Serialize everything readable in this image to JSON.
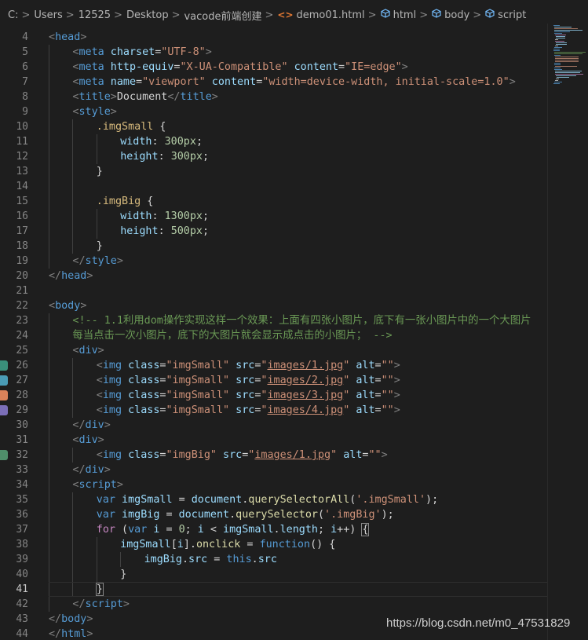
{
  "breadcrumb": {
    "items": [
      "C:",
      "Users",
      "12525",
      "Desktop",
      "vacode前端创建",
      "demo01.html",
      "html",
      "body",
      "script"
    ],
    "separator": ">"
  },
  "editor": {
    "active_line": 41,
    "lines": [
      {
        "n": "4"
      },
      {
        "n": "5"
      },
      {
        "n": "6"
      },
      {
        "n": "7"
      },
      {
        "n": "8"
      },
      {
        "n": "9"
      },
      {
        "n": "10"
      },
      {
        "n": "11"
      },
      {
        "n": "12"
      },
      {
        "n": "13"
      },
      {
        "n": "14"
      },
      {
        "n": "15"
      },
      {
        "n": "16"
      },
      {
        "n": "17"
      },
      {
        "n": "18"
      },
      {
        "n": "19"
      },
      {
        "n": "20"
      },
      {
        "n": "21"
      },
      {
        "n": "22"
      },
      {
        "n": "23"
      },
      {
        "n": "24"
      },
      {
        "n": "25"
      },
      {
        "n": "26"
      },
      {
        "n": "27"
      },
      {
        "n": "28"
      },
      {
        "n": "29"
      },
      {
        "n": "30"
      },
      {
        "n": "31"
      },
      {
        "n": "32"
      },
      {
        "n": "33"
      },
      {
        "n": "34"
      },
      {
        "n": "35"
      },
      {
        "n": "36"
      },
      {
        "n": "37"
      },
      {
        "n": "38"
      },
      {
        "n": "39"
      },
      {
        "n": "40"
      },
      {
        "n": "41"
      },
      {
        "n": "42"
      },
      {
        "n": "43"
      },
      {
        "n": "44"
      }
    ],
    "code": {
      "l4": [
        "<",
        "head",
        ">"
      ],
      "l5": [
        "<",
        "meta",
        " ",
        "charset",
        "=",
        "\"UTF-8\"",
        ">"
      ],
      "l6": [
        "<",
        "meta",
        " ",
        "http-equiv",
        "=",
        "\"X-UA-Compatible\"",
        " ",
        "content",
        "=",
        "\"IE=edge\"",
        ">"
      ],
      "l7": [
        "<",
        "meta",
        " ",
        "name",
        "=",
        "\"viewport\"",
        " ",
        "content",
        "=",
        "\"width=device-width, initial-scale=1.0\"",
        ">"
      ],
      "l8": [
        "<",
        "title",
        ">",
        "Document",
        "</",
        "title",
        ">"
      ],
      "l9": [
        "<",
        "style",
        ">"
      ],
      "l10": [
        ".imgSmall",
        " {"
      ],
      "l11": [
        "width",
        ": ",
        "300px",
        ";"
      ],
      "l12": [
        "height",
        ": ",
        "300px",
        ";"
      ],
      "l13": [
        "}"
      ],
      "l15": [
        ".imgBig",
        " {"
      ],
      "l16": [
        "width",
        ": ",
        "1300px",
        ";"
      ],
      "l17": [
        "height",
        ": ",
        "500px",
        ";"
      ],
      "l18": [
        "}"
      ],
      "l19": [
        "</",
        "style",
        ">"
      ],
      "l20": [
        "</",
        "head",
        ">"
      ],
      "l22": [
        "<",
        "body",
        ">"
      ],
      "l23": [
        "<!-- 1.1利用dom操作实现这样一个效果：上面有四张小图片，底下有一张小图片中的一个大图片"
      ],
      "l24": [
        "每当点击一次小图片，底下的大图片就会显示成点击的小图片； -->"
      ],
      "l25": [
        "<",
        "div",
        ">"
      ],
      "img_small": [
        [
          "<",
          "img",
          " ",
          "class",
          "=",
          "\"imgSmall\"",
          " ",
          "src",
          "=",
          "\"",
          "images/1.jpg",
          "\"",
          " ",
          "alt",
          "=",
          "\"\"",
          ">"
        ],
        [
          "<",
          "img",
          " ",
          "class",
          "=",
          "\"imgSmall\"",
          " ",
          "src",
          "=",
          "\"",
          "images/2.jpg",
          "\"",
          " ",
          "alt",
          "=",
          "\"\"",
          ">"
        ],
        [
          "<",
          "img",
          " ",
          "class",
          "=",
          "\"imgSmall\"",
          " ",
          "src",
          "=",
          "\"",
          "images/3.jpg",
          "\"",
          " ",
          "alt",
          "=",
          "\"\"",
          ">"
        ],
        [
          "<",
          "img",
          " ",
          "class",
          "=",
          "\"imgSmall\"",
          " ",
          "src",
          "=",
          "\"",
          "images/4.jpg",
          "\"",
          " ",
          "alt",
          "=",
          "\"\"",
          ">"
        ]
      ],
      "l30": [
        "</",
        "div",
        ">"
      ],
      "l31": [
        "<",
        "div",
        ">"
      ],
      "l32": [
        "<",
        "img",
        " ",
        "class",
        "=",
        "\"imgBig\"",
        " ",
        "src",
        "=",
        "\"",
        "images/1.jpg",
        "\"",
        " ",
        "alt",
        "=",
        "\"\"",
        ">"
      ],
      "l33": [
        "</",
        "div",
        ">"
      ],
      "l34": [
        "<",
        "script",
        ">"
      ],
      "l35": [
        "var",
        " ",
        "imgSmall",
        " = ",
        "document",
        ".",
        "querySelectorAll",
        "(",
        "'.imgSmall'",
        ");"
      ],
      "l36": [
        "var",
        " ",
        "imgBig",
        " = ",
        "document",
        ".",
        "querySelector",
        "(",
        "'.imgBig'",
        ");"
      ],
      "l37": [
        "for",
        " (",
        "var",
        " ",
        "i",
        " = ",
        "0",
        "; ",
        "i",
        " < ",
        "imgSmall",
        ".",
        "length",
        "; ",
        "i",
        "++) ",
        "{"
      ],
      "l38": [
        "imgSmall",
        "[",
        "i",
        "].",
        "onclick",
        " = ",
        "function",
        "() {"
      ],
      "l39": [
        "imgBig",
        ".",
        "src",
        " = ",
        "this",
        ".",
        "src"
      ],
      "l40": [
        "}"
      ],
      "l41": [
        "}"
      ],
      "l42": [
        "</",
        "script",
        ">"
      ],
      "l43": [
        "</",
        "body",
        ">"
      ],
      "l44": [
        "</",
        "html",
        ">"
      ]
    }
  },
  "gutter_thumb_colors": [
    "#3a8f7a",
    "#4a9cb6",
    "#d9825a",
    "#7c6fb8",
    "#4f8f6a"
  ],
  "theme": {
    "background": "#1e1e1e",
    "tag": "#569cd6",
    "attribute": "#9cdcfe",
    "string": "#ce9178",
    "comment": "#6a9955",
    "selector": "#d7ba7d",
    "number": "#b5cea8",
    "keyword_control": "#c586c0",
    "function": "#dcdcaa"
  },
  "watermark": "https://blog.csdn.net/m0_47531829"
}
